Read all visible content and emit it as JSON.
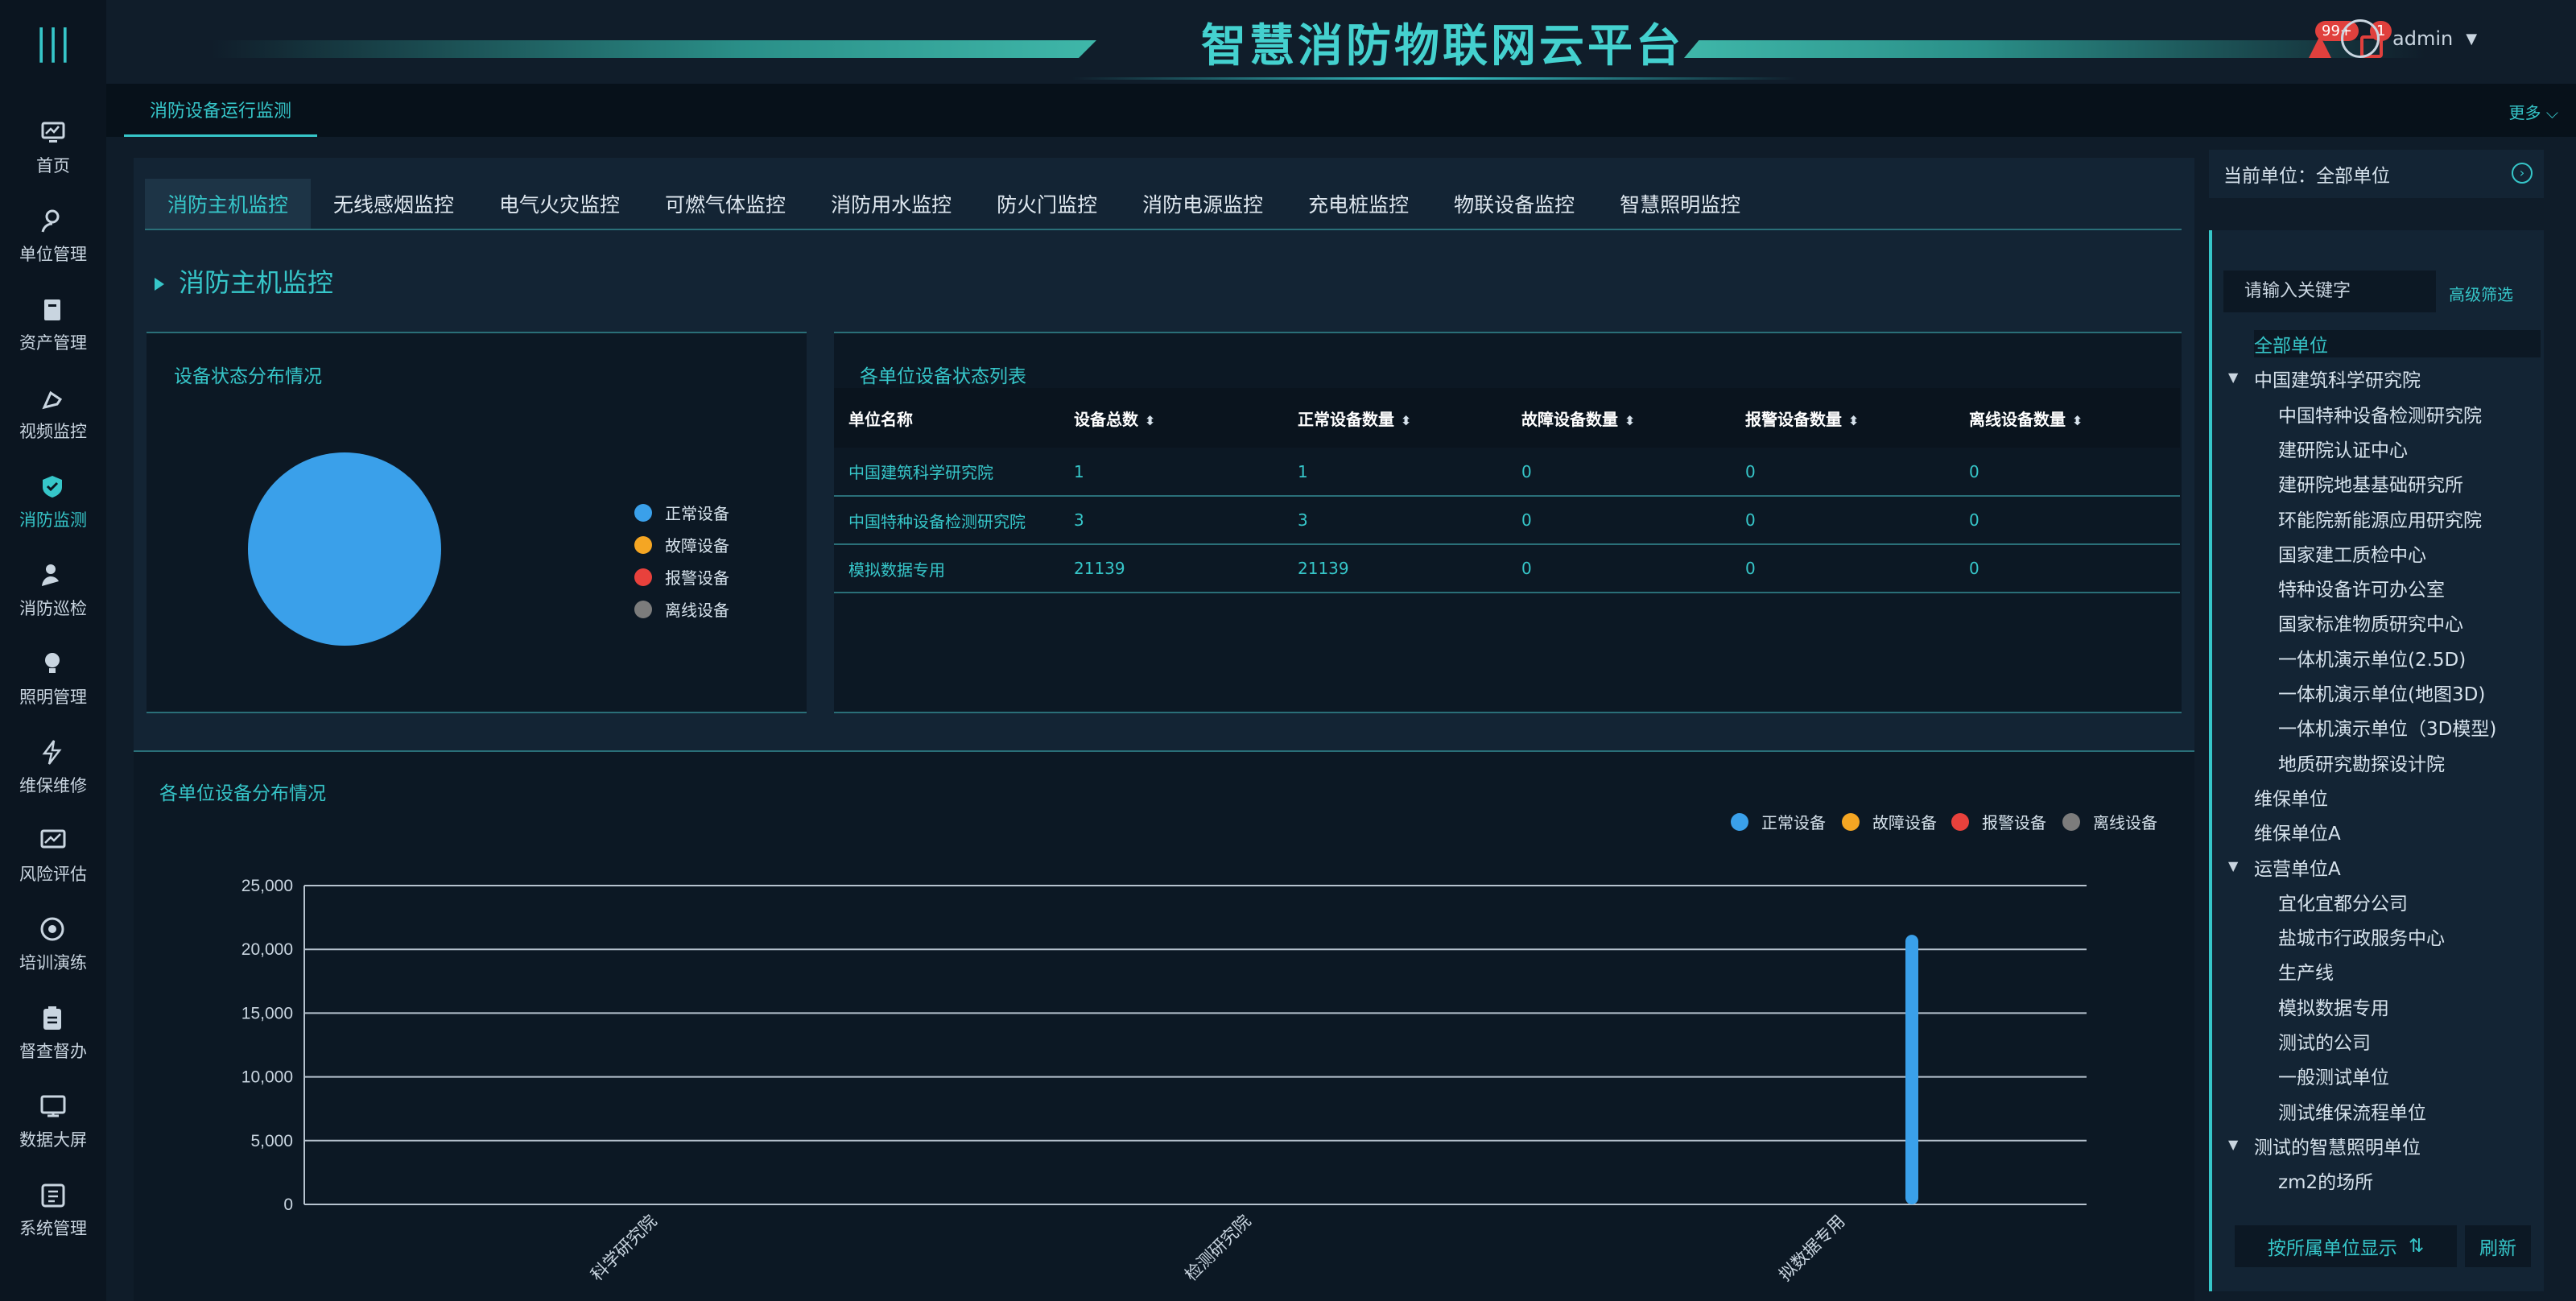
{
  "app": {
    "title": "智慧消防物联网云平台"
  },
  "header": {
    "badge_1": "99+",
    "badge_2": "1",
    "user": "admin"
  },
  "sidebar": {
    "items": [
      {
        "label": "首页",
        "icon": "monitor-icon"
      },
      {
        "label": "单位管理",
        "icon": "user-icon"
      },
      {
        "label": "资产管理",
        "icon": "asset-icon"
      },
      {
        "label": "视频监控",
        "icon": "camera-icon"
      },
      {
        "label": "消防监测",
        "icon": "shield-icon"
      },
      {
        "label": "消防巡检",
        "icon": "inspector-icon"
      },
      {
        "label": "照明管理",
        "icon": "lamp-icon"
      },
      {
        "label": "维保维修",
        "icon": "bolt-icon"
      },
      {
        "label": "风险评估",
        "icon": "chart-icon"
      },
      {
        "label": "培训演练",
        "icon": "target-icon"
      },
      {
        "label": "督查督办",
        "icon": "clipboard-icon"
      },
      {
        "label": "数据大屏",
        "icon": "screen-icon"
      },
      {
        "label": "系统管理",
        "icon": "settings-icon"
      }
    ]
  },
  "page_tab": {
    "label": "消防设备运行监测",
    "more": "更多"
  },
  "subtabs": [
    "消防主机监控",
    "无线感烟监控",
    "电气火灾监控",
    "可燃气体监控",
    "消防用水监控",
    "防火门监控",
    "消防电源监控",
    "充电桩监控",
    "物联设备监控",
    "智慧照明监控"
  ],
  "section": {
    "title": "消防主机监控"
  },
  "status_panel": {
    "title": "设备状态分布情况"
  },
  "legend": [
    "正常设备",
    "故障设备",
    "报警设备",
    "离线设备"
  ],
  "colors": {
    "normal": "#3aa0ea",
    "fault": "#f5a623",
    "alarm": "#e8413c",
    "offline": "#7c7c7c",
    "accent": "#36c6c9"
  },
  "table": {
    "title": "各单位设备状态列表",
    "headers": [
      "单位名称",
      "设备总数",
      "正常设备数量",
      "故障设备数量",
      "报警设备数量",
      "离线设备数量"
    ],
    "rows": [
      [
        "中国建筑科学研究院",
        "1",
        "1",
        "0",
        "0",
        "0"
      ],
      [
        "中国特种设备检测研究院",
        "3",
        "3",
        "0",
        "0",
        "0"
      ],
      [
        "模拟数据专用",
        "21139",
        "21139",
        "0",
        "0",
        "0"
      ]
    ]
  },
  "chart_panel": {
    "title": "各单位设备分布情况"
  },
  "chart_data": [
    {
      "type": "pie",
      "title": "设备状态分布情况",
      "labels": [
        "正常设备",
        "故障设备",
        "报警设备",
        "离线设备"
      ],
      "values": [
        21143,
        0,
        0,
        0
      ]
    },
    {
      "type": "bar",
      "title": "各单位设备分布情况",
      "categories": [
        "科学研究院",
        "检测研究院",
        "拟数据专用"
      ],
      "series": [
        {
          "name": "正常设备",
          "values": [
            1,
            3,
            21139
          ]
        },
        {
          "name": "故障设备",
          "values": [
            0,
            0,
            0
          ]
        },
        {
          "name": "报警设备",
          "values": [
            0,
            0,
            0
          ]
        },
        {
          "name": "离线设备",
          "values": [
            0,
            0,
            0
          ]
        }
      ],
      "ylim": [
        0,
        25000
      ],
      "yticks": [
        "25,000",
        "20,000",
        "15,000",
        "10,000",
        "5,000",
        "0"
      ],
      "grid": true,
      "legend": "top-right"
    }
  ],
  "right_panel": {
    "current_unit_label": "当前单位：全部单位",
    "search_placeholder": "请输入关键字",
    "advanced": "高级筛选",
    "tree": [
      {
        "label": "全部单位",
        "level": 0,
        "selected": true
      },
      {
        "label": "中国建筑科学研究院",
        "level": 0,
        "expanded": true
      },
      {
        "label": "中国特种设备检测研究院",
        "level": 1
      },
      {
        "label": "建研院认证中心",
        "level": 1
      },
      {
        "label": "建研院地基基础研究所",
        "level": 1
      },
      {
        "label": "环能院新能源应用研究院",
        "level": 1
      },
      {
        "label": "国家建工质检中心",
        "level": 1
      },
      {
        "label": "特种设备许可办公室",
        "level": 1
      },
      {
        "label": "国家标准物质研究中心",
        "level": 1
      },
      {
        "label": "一体机演示单位(2.5D)",
        "level": 1
      },
      {
        "label": "一体机演示单位(地图3D)",
        "level": 1
      },
      {
        "label": "一体机演示单位（3D模型)",
        "level": 1
      },
      {
        "label": "地质研究勘探设计院",
        "level": 1
      },
      {
        "label": "维保单位",
        "level": 0
      },
      {
        "label": "维保单位A",
        "level": 0
      },
      {
        "label": "运营单位A",
        "level": 0,
        "expanded": true
      },
      {
        "label": "宜化宜都分公司",
        "level": 1
      },
      {
        "label": "盐城市行政服务中心",
        "level": 1
      },
      {
        "label": "生产线",
        "level": 1
      },
      {
        "label": "模拟数据专用",
        "level": 1
      },
      {
        "label": "测试的公司",
        "level": 1
      },
      {
        "label": "一般测试单位",
        "level": 1
      },
      {
        "label": "测试维保流程单位",
        "level": 1
      },
      {
        "label": "测试的智慧照明单位",
        "level": 0,
        "expanded": true
      },
      {
        "label": "zm2的场所",
        "level": 1
      }
    ],
    "show_by_unit": "按所属单位显示",
    "refresh": "刷新"
  }
}
